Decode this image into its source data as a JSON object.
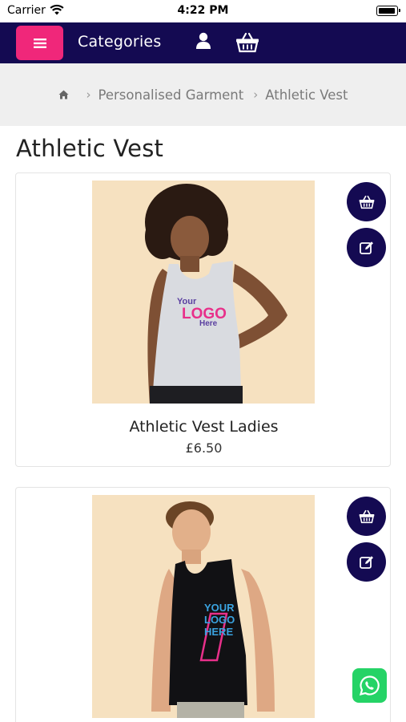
{
  "status_bar": {
    "carrier": "Carrier",
    "time": "4:22 PM"
  },
  "header": {
    "categories_label": "Categories"
  },
  "breadcrumb": {
    "items": [
      "Personalised Garment",
      "Athletic Vest"
    ]
  },
  "page": {
    "title": "Athletic Vest"
  },
  "products": [
    {
      "name": "Athletic Vest Ladies",
      "price": "£6.50",
      "print_text": [
        "Your",
        "LOGO",
        "Here"
      ]
    },
    {
      "name": "",
      "price": "",
      "print_text": [
        "YOUR",
        "LOGO",
        "HERE"
      ]
    }
  ],
  "colors": {
    "header_bg": "#140a52",
    "menu_accent": "#f0277a",
    "whatsapp": "#25d366",
    "breadcrumb_bg": "#efefef"
  },
  "icons": [
    "wifi-icon",
    "battery-icon",
    "menu-icon",
    "user-icon",
    "basket-icon",
    "home-icon",
    "edit-icon",
    "whatsapp-icon"
  ]
}
